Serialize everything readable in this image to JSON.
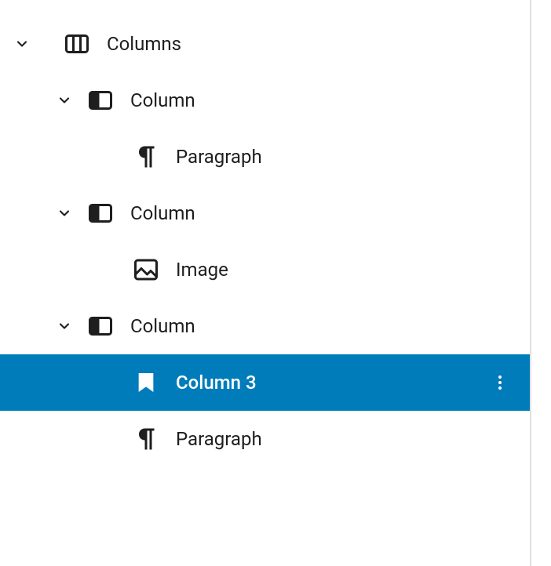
{
  "tree": {
    "root": {
      "label": "Columns",
      "expanded": true
    },
    "col1": {
      "label": "Column",
      "expanded": true
    },
    "col1_child": {
      "label": "Paragraph"
    },
    "col2": {
      "label": "Column",
      "expanded": true
    },
    "col2_child": {
      "label": "Image"
    },
    "col3": {
      "label": "Column",
      "expanded": true
    },
    "col3_child1": {
      "label": "Column 3",
      "selected": true
    },
    "col3_child2": {
      "label": "Paragraph"
    }
  },
  "colors": {
    "selected_bg": "#007cba",
    "text": "#1e1e1e"
  }
}
